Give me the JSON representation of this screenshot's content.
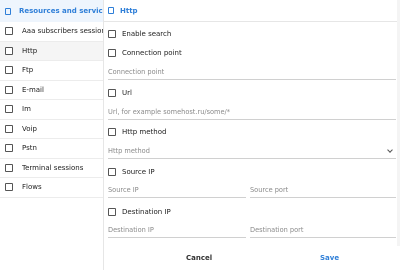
{
  "left": {
    "header": "Resources and services",
    "items": [
      {
        "label": "Aaa subscribers sessions"
      },
      {
        "label": "Http"
      },
      {
        "label": "Ftp"
      },
      {
        "label": "E-mail"
      },
      {
        "label": "Im"
      },
      {
        "label": "Voip"
      },
      {
        "label": "Pstn"
      },
      {
        "label": "Terminal sessions"
      },
      {
        "label": "Flows"
      }
    ]
  },
  "right": {
    "header": "Http",
    "enable_search": "Enable search",
    "connection_point": "Connection point",
    "connection_point_placeholder": "Connection point",
    "url": "Url",
    "url_placeholder": "Url, for example somehost.ru/some/*",
    "http_method": "Http method",
    "http_method_select": "Http method",
    "source_ip": "Source IP",
    "source_ip_placeholder": "Source IP",
    "source_port_placeholder": "Source port",
    "destination_ip": "Destination IP",
    "destination_ip_placeholder": "Destination IP",
    "destination_port_placeholder": "Destination port"
  },
  "footer": {
    "cancel": "Cancel",
    "save": "Save"
  },
  "colors": {
    "accent": "#2f7fd8",
    "header_bg": "#eef5fd"
  }
}
